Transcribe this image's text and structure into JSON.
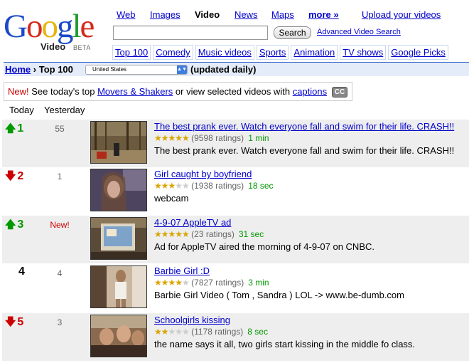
{
  "logo": {
    "video": "Video",
    "beta": "BETA"
  },
  "topnav": {
    "web": "Web",
    "images": "Images",
    "video": "Video",
    "news": "News",
    "maps": "Maps",
    "more": "more »",
    "upload": "Upload your videos"
  },
  "search": {
    "value": "",
    "button": "Search",
    "advanced": "Advanced Video Search"
  },
  "categories": [
    "Top 100",
    "Comedy",
    "Music videos",
    "Sports",
    "Animation",
    "TV shows",
    "Google Picks"
  ],
  "breadcrumb": {
    "home": "Home",
    "separator": "›",
    "current": "Top 100",
    "region": "United States",
    "updated": "(updated daily)"
  },
  "notice": {
    "new": "New!",
    "text1": "See today's top",
    "movers": "Movers & Shakers",
    "text2": "or view selected videos with",
    "captions": "captions",
    "cc": "CC"
  },
  "columns": {
    "today": "Today",
    "yesterday": "Yesterday"
  },
  "videos": [
    {
      "rank": "1",
      "trend": "up",
      "prev": "55",
      "title": "The best prank ever. Watch everyone fall and swim for their life. CRASH!!",
      "stars": 4.5,
      "ratings": "(9598 ratings)",
      "duration": "1 min",
      "desc": "The best prank ever. Watch everyone fall and swim for their life. CRASH!!"
    },
    {
      "rank": "2",
      "trend": "down",
      "prev": "1",
      "title": "Girl caught by boyfriend ",
      "stars": 3,
      "ratings": "(1938 ratings)",
      "duration": "18 sec",
      "desc": "webcam"
    },
    {
      "rank": "3",
      "trend": "up",
      "prev": "New!",
      "title": "4-9-07 AppleTV ad ",
      "stars": 4.5,
      "ratings": "(23 ratings)",
      "duration": "31 sec",
      "desc": "Ad for AppleTV aired the morning of 4-9-07 on CNBC."
    },
    {
      "rank": "4",
      "trend": "none",
      "prev": "4",
      "title": "Barbie Girl :D ",
      "stars": 3.5,
      "ratings": "(7827 ratings)",
      "duration": "3 min",
      "desc": "Barbie Girl Video ( Tom , Sandra ) LOL -> www.be-dumb.com"
    },
    {
      "rank": "5",
      "trend": "down",
      "prev": "3",
      "title": "Schoolgirls kissing ",
      "stars": 2,
      "ratings": "(1178 ratings)",
      "duration": "8 sec",
      "desc": "the name says it all, two girls start kissing in the middle fo class."
    }
  ],
  "colors": {
    "link": "#0000cc",
    "up": "#009900",
    "down": "#cc0000",
    "duration": "#009900",
    "star": "#d9a400",
    "bar": "#e5ecf9"
  }
}
